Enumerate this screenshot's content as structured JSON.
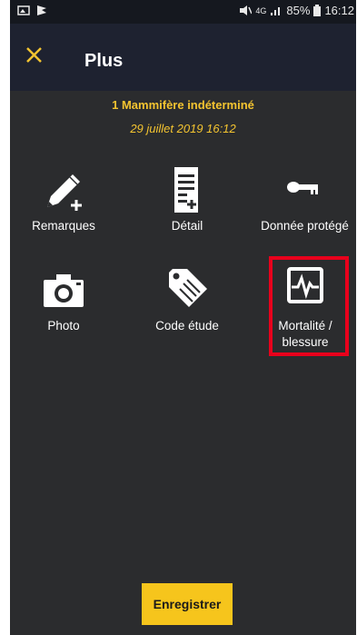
{
  "status_bar": {
    "network": "4G",
    "battery": "85%",
    "time": "16:12"
  },
  "appbar": {
    "title": "Plus",
    "close_icon": "close-icon"
  },
  "header": {
    "subtitle": "1 Mammifère indéterminé",
    "date": "29 juillet 2019 16:12"
  },
  "tiles": [
    {
      "label": "Remarques",
      "icon": "pencil-plus-icon"
    },
    {
      "label": "Détail",
      "icon": "document-add-icon"
    },
    {
      "label": "Donnée protégé",
      "icon": "key-icon"
    },
    {
      "label": "Photo",
      "icon": "camera-icon"
    },
    {
      "label": "Code étude",
      "icon": "tag-icon"
    },
    {
      "label": "Mortalité / blessure",
      "icon": "heartbeat-icon"
    }
  ],
  "highlighted_tile": "Mortalité / blessure",
  "colors": {
    "accent": "#f4c430",
    "button": "#f6c51c",
    "highlight": "#e8001c",
    "background": "#2b2c2e"
  },
  "save_button": {
    "label": "Enregistrer"
  }
}
